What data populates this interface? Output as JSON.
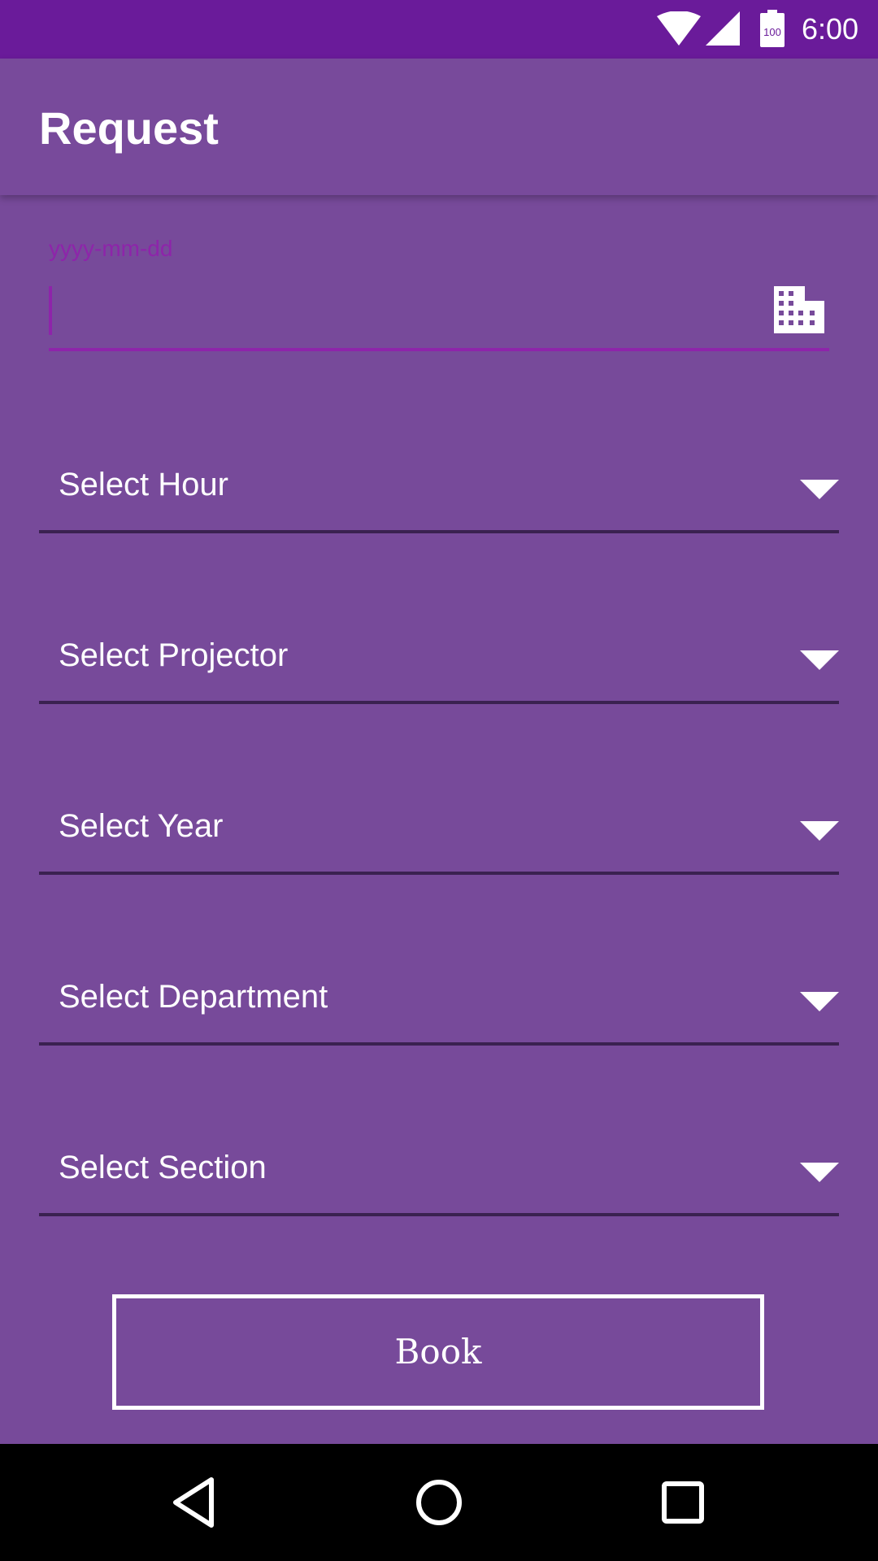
{
  "status_bar": {
    "time": "6:00",
    "battery_level": "100",
    "icons": [
      "wifi-icon",
      "signal-icon",
      "battery-icon"
    ]
  },
  "app_bar": {
    "title": "Request"
  },
  "date_field": {
    "hint": "yyyy-mm-dd",
    "value": "",
    "icon": "calendar-icon"
  },
  "spinners": [
    {
      "label": "Select Hour"
    },
    {
      "label": "Select Projector"
    },
    {
      "label": "Select Year"
    },
    {
      "label": "Select Department"
    },
    {
      "label": "Select Section"
    }
  ],
  "book_button": {
    "label": "Book"
  },
  "nav_bar": {
    "icons": [
      "back-icon",
      "home-icon",
      "recents-icon"
    ]
  },
  "colors": {
    "status_bar": "#6a1b9a",
    "background": "#774a9a",
    "accent": "#8e24aa",
    "spinner_underline": "#3a2150"
  }
}
